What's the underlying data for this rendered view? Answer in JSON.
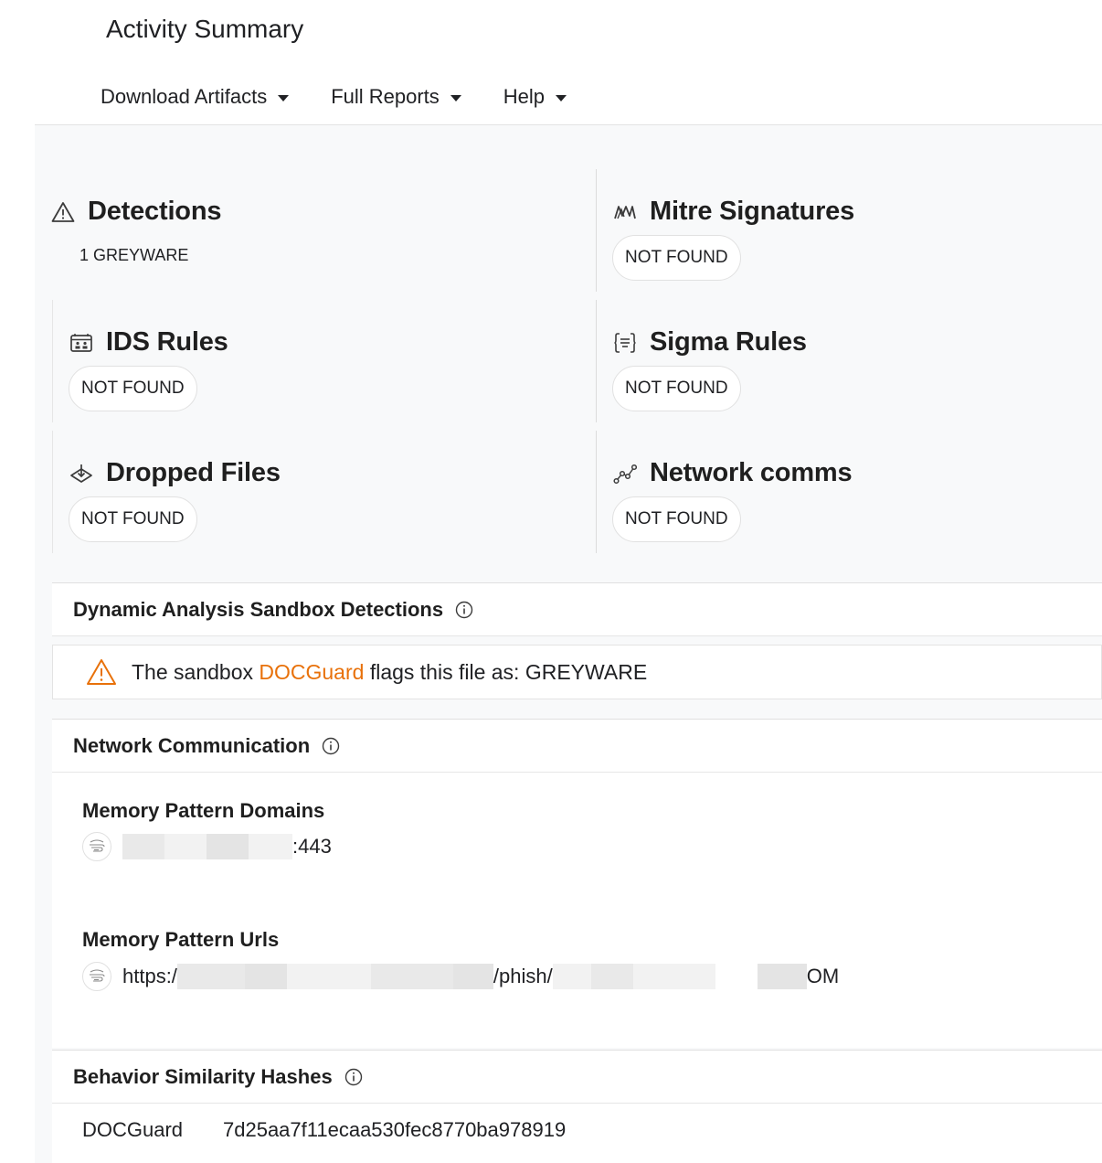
{
  "page": {
    "title": "Activity Summary"
  },
  "menu": {
    "items": [
      {
        "label": "Download Artifacts",
        "icon": "caret-down-icon"
      },
      {
        "label": "Full Reports",
        "icon": "caret-down-icon"
      },
      {
        "label": "Help",
        "icon": "caret-down-icon"
      }
    ]
  },
  "summary": {
    "detections": {
      "title": "Detections",
      "icon": "warning-triangle-icon",
      "value": "1 GREYWARE"
    },
    "mitre": {
      "title": "Mitre Signatures",
      "icon": "mitre-icon",
      "value": "NOT FOUND"
    },
    "ids": {
      "title": "IDS Rules",
      "icon": "ids-rules-icon",
      "value": "NOT FOUND"
    },
    "sigma": {
      "title": "Sigma Rules",
      "icon": "sigma-rules-icon",
      "value": "NOT FOUND"
    },
    "dropped": {
      "title": "Dropped Files",
      "icon": "dropped-files-icon",
      "value": "NOT FOUND"
    },
    "network": {
      "title": "Network comms",
      "icon": "network-comms-icon",
      "value": "NOT FOUND"
    }
  },
  "sandbox": {
    "title": "Dynamic Analysis Sandbox Detections",
    "prefix": "The sandbox",
    "engine": "DOCGuard",
    "suffix": "flags this file as: GREYWARE"
  },
  "network": {
    "title": "Network Communication",
    "domains_title": "Memory Pattern Domains",
    "domain_tail": ":443",
    "urls_title": "Memory Pattern Urls",
    "url_start": "https:/",
    "url_mid": "/phish/",
    "url_end": "OM"
  },
  "hashes": {
    "title": "Behavior Similarity Hashes",
    "rows": [
      {
        "engine": "DOCGuard",
        "hash": "7d25aa7f11ecaa530fec8770ba978919"
      }
    ]
  },
  "colors": {
    "accent": "#e8710a",
    "background": "#f8f9fa"
  }
}
